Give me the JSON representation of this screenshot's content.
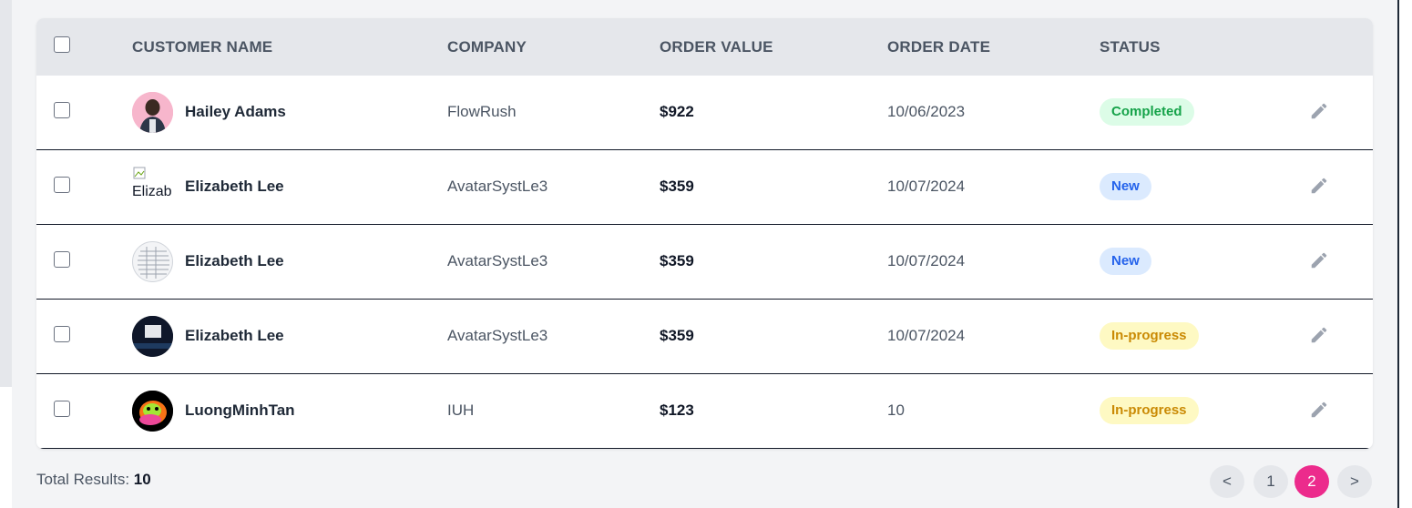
{
  "table": {
    "headers": [
      "CUSTOMER NAME",
      "COMPANY",
      "ORDER VALUE",
      "ORDER DATE",
      "STATUS"
    ],
    "rows": [
      {
        "name": "Hailey Adams",
        "company": "FlowRush",
        "value": "$922",
        "date": "10/06/2023",
        "status": "Completed",
        "avatar_alt": ""
      },
      {
        "name": "Elizabeth Lee",
        "company": "AvatarSystLe3",
        "value": "$359",
        "date": "10/07/2024",
        "status": "New",
        "avatar_alt": "Elizab"
      },
      {
        "name": "Elizabeth Lee",
        "company": "AvatarSystLe3",
        "value": "$359",
        "date": "10/07/2024",
        "status": "New",
        "avatar_alt": ""
      },
      {
        "name": "Elizabeth Lee",
        "company": "AvatarSystLe3",
        "value": "$359",
        "date": "10/07/2024",
        "status": "In-progress",
        "avatar_alt": ""
      },
      {
        "name": "LuongMinhTan",
        "company": "IUH",
        "value": "$123",
        "date": "10",
        "status": "In-progress",
        "avatar_alt": ""
      }
    ]
  },
  "footer": {
    "total_label": "Total Results:",
    "total_value": "10"
  },
  "pagination": {
    "prev": "<",
    "pages": [
      "1",
      "2"
    ],
    "next": ">",
    "active_page": "2"
  },
  "colors": {
    "completed_bg": "#dcfce7",
    "completed_fg": "#16a34a",
    "new_bg": "#dbeafe",
    "new_fg": "#2563eb",
    "progress_bg": "#fef9c3",
    "progress_fg": "#ca8a04",
    "accent": "#ec2b8c"
  },
  "icons": {
    "edit": "pencil-icon"
  }
}
